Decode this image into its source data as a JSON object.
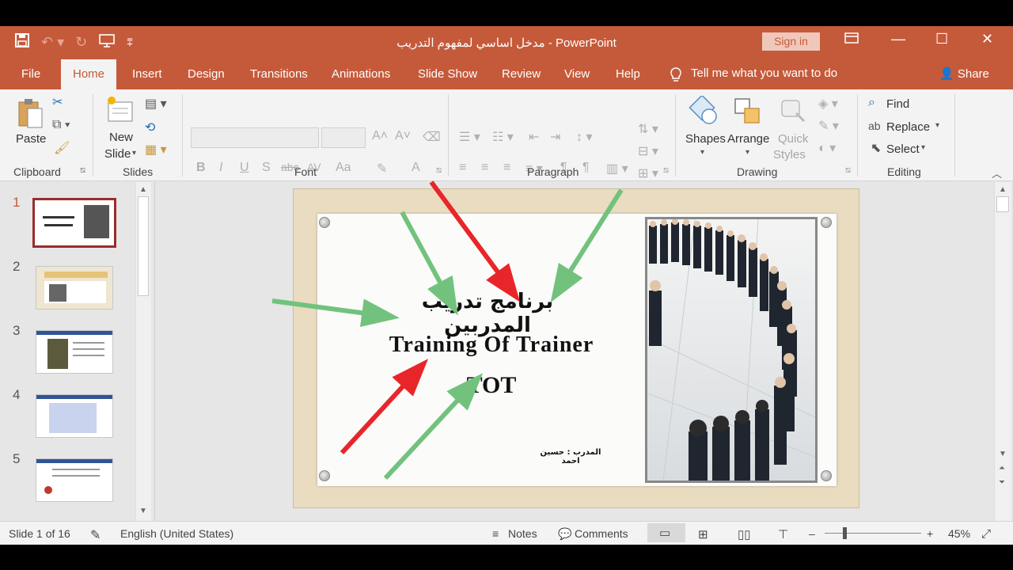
{
  "titlebar": {
    "title": "مدخل اساسي لمفهوم التدريب  -  PowerPoint",
    "signin": "Sign in",
    "qat": {
      "save_icon": "save-icon",
      "undo_icon": "undo-icon",
      "redo_icon": "redo-icon",
      "present_icon": "present-from-beginning-icon",
      "customize_icon": "customize-qat-icon"
    }
  },
  "tabs": [
    {
      "label": "File"
    },
    {
      "label": "Home"
    },
    {
      "label": "Insert"
    },
    {
      "label": "Design"
    },
    {
      "label": "Transitions"
    },
    {
      "label": "Animations"
    },
    {
      "label": "Slide Show"
    },
    {
      "label": "Review"
    },
    {
      "label": "View"
    },
    {
      "label": "Help"
    }
  ],
  "tellme": "Tell me what you want to do",
  "share": "Share",
  "ribbon": {
    "clipboard": {
      "label": "Clipboard",
      "paste": "Paste"
    },
    "slides": {
      "label": "Slides",
      "new_slide_1": "New",
      "new_slide_2": "Slide"
    },
    "font": {
      "label": "Font",
      "bold": "B",
      "italic": "I",
      "underline": "U",
      "shadow": "S",
      "strike": "abc",
      "spacing": "AV",
      "case": "Aa",
      "color": "A"
    },
    "paragraph": {
      "label": "Paragraph"
    },
    "drawing": {
      "label": "Drawing",
      "shapes": "Shapes",
      "arrange": "Arrange",
      "quick_1": "Quick",
      "quick_2": "Styles"
    },
    "editing": {
      "label": "Editing",
      "find": "Find",
      "replace": "Replace",
      "select": "Select"
    }
  },
  "thumbnails": [
    {
      "num": "1",
      "selected": true
    },
    {
      "num": "2",
      "selected": false
    },
    {
      "num": "3",
      "selected": false
    },
    {
      "num": "4",
      "selected": false
    },
    {
      "num": "5",
      "selected": false
    }
  ],
  "slide": {
    "arabic_title": "برنامج تدريب المدربين",
    "english_title": "Training Of  Trainer",
    "tot": "TOT",
    "trainer": "المدرب : حسين احمد"
  },
  "status": {
    "slide_of": "Slide 1 of 16",
    "language": "English (United States)",
    "notes": "Notes",
    "comments": "Comments",
    "zoom": "45%",
    "zoom_minus": "–",
    "zoom_plus": "+"
  },
  "colors": {
    "accent": "#c55a3b",
    "arrow_red": "#e8262a",
    "arrow_green": "#72c27d"
  }
}
